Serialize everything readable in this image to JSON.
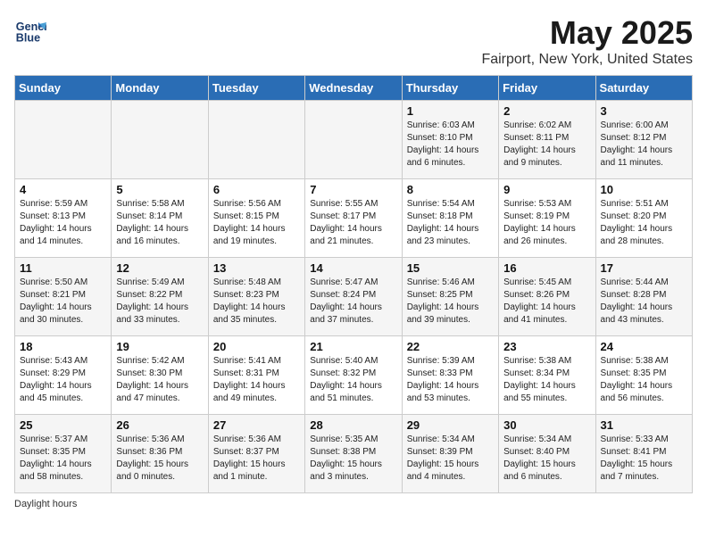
{
  "header": {
    "logo_line1": "General",
    "logo_line2": "Blue",
    "title": "May 2025",
    "subtitle": "Fairport, New York, United States"
  },
  "weekdays": [
    "Sunday",
    "Monday",
    "Tuesday",
    "Wednesday",
    "Thursday",
    "Friday",
    "Saturday"
  ],
  "legend": "Daylight hours",
  "weeks": [
    [
      {
        "day": "",
        "info": ""
      },
      {
        "day": "",
        "info": ""
      },
      {
        "day": "",
        "info": ""
      },
      {
        "day": "",
        "info": ""
      },
      {
        "day": "1",
        "info": "Sunrise: 6:03 AM\nSunset: 8:10 PM\nDaylight: 14 hours\nand 6 minutes."
      },
      {
        "day": "2",
        "info": "Sunrise: 6:02 AM\nSunset: 8:11 PM\nDaylight: 14 hours\nand 9 minutes."
      },
      {
        "day": "3",
        "info": "Sunrise: 6:00 AM\nSunset: 8:12 PM\nDaylight: 14 hours\nand 11 minutes."
      }
    ],
    [
      {
        "day": "4",
        "info": "Sunrise: 5:59 AM\nSunset: 8:13 PM\nDaylight: 14 hours\nand 14 minutes."
      },
      {
        "day": "5",
        "info": "Sunrise: 5:58 AM\nSunset: 8:14 PM\nDaylight: 14 hours\nand 16 minutes."
      },
      {
        "day": "6",
        "info": "Sunrise: 5:56 AM\nSunset: 8:15 PM\nDaylight: 14 hours\nand 19 minutes."
      },
      {
        "day": "7",
        "info": "Sunrise: 5:55 AM\nSunset: 8:17 PM\nDaylight: 14 hours\nand 21 minutes."
      },
      {
        "day": "8",
        "info": "Sunrise: 5:54 AM\nSunset: 8:18 PM\nDaylight: 14 hours\nand 23 minutes."
      },
      {
        "day": "9",
        "info": "Sunrise: 5:53 AM\nSunset: 8:19 PM\nDaylight: 14 hours\nand 26 minutes."
      },
      {
        "day": "10",
        "info": "Sunrise: 5:51 AM\nSunset: 8:20 PM\nDaylight: 14 hours\nand 28 minutes."
      }
    ],
    [
      {
        "day": "11",
        "info": "Sunrise: 5:50 AM\nSunset: 8:21 PM\nDaylight: 14 hours\nand 30 minutes."
      },
      {
        "day": "12",
        "info": "Sunrise: 5:49 AM\nSunset: 8:22 PM\nDaylight: 14 hours\nand 33 minutes."
      },
      {
        "day": "13",
        "info": "Sunrise: 5:48 AM\nSunset: 8:23 PM\nDaylight: 14 hours\nand 35 minutes."
      },
      {
        "day": "14",
        "info": "Sunrise: 5:47 AM\nSunset: 8:24 PM\nDaylight: 14 hours\nand 37 minutes."
      },
      {
        "day": "15",
        "info": "Sunrise: 5:46 AM\nSunset: 8:25 PM\nDaylight: 14 hours\nand 39 minutes."
      },
      {
        "day": "16",
        "info": "Sunrise: 5:45 AM\nSunset: 8:26 PM\nDaylight: 14 hours\nand 41 minutes."
      },
      {
        "day": "17",
        "info": "Sunrise: 5:44 AM\nSunset: 8:28 PM\nDaylight: 14 hours\nand 43 minutes."
      }
    ],
    [
      {
        "day": "18",
        "info": "Sunrise: 5:43 AM\nSunset: 8:29 PM\nDaylight: 14 hours\nand 45 minutes."
      },
      {
        "day": "19",
        "info": "Sunrise: 5:42 AM\nSunset: 8:30 PM\nDaylight: 14 hours\nand 47 minutes."
      },
      {
        "day": "20",
        "info": "Sunrise: 5:41 AM\nSunset: 8:31 PM\nDaylight: 14 hours\nand 49 minutes."
      },
      {
        "day": "21",
        "info": "Sunrise: 5:40 AM\nSunset: 8:32 PM\nDaylight: 14 hours\nand 51 minutes."
      },
      {
        "day": "22",
        "info": "Sunrise: 5:39 AM\nSunset: 8:33 PM\nDaylight: 14 hours\nand 53 minutes."
      },
      {
        "day": "23",
        "info": "Sunrise: 5:38 AM\nSunset: 8:34 PM\nDaylight: 14 hours\nand 55 minutes."
      },
      {
        "day": "24",
        "info": "Sunrise: 5:38 AM\nSunset: 8:35 PM\nDaylight: 14 hours\nand 56 minutes."
      }
    ],
    [
      {
        "day": "25",
        "info": "Sunrise: 5:37 AM\nSunset: 8:35 PM\nDaylight: 14 hours\nand 58 minutes."
      },
      {
        "day": "26",
        "info": "Sunrise: 5:36 AM\nSunset: 8:36 PM\nDaylight: 15 hours\nand 0 minutes."
      },
      {
        "day": "27",
        "info": "Sunrise: 5:36 AM\nSunset: 8:37 PM\nDaylight: 15 hours\nand 1 minute."
      },
      {
        "day": "28",
        "info": "Sunrise: 5:35 AM\nSunset: 8:38 PM\nDaylight: 15 hours\nand 3 minutes."
      },
      {
        "day": "29",
        "info": "Sunrise: 5:34 AM\nSunset: 8:39 PM\nDaylight: 15 hours\nand 4 minutes."
      },
      {
        "day": "30",
        "info": "Sunrise: 5:34 AM\nSunset: 8:40 PM\nDaylight: 15 hours\nand 6 minutes."
      },
      {
        "day": "31",
        "info": "Sunrise: 5:33 AM\nSunset: 8:41 PM\nDaylight: 15 hours\nand 7 minutes."
      }
    ]
  ]
}
